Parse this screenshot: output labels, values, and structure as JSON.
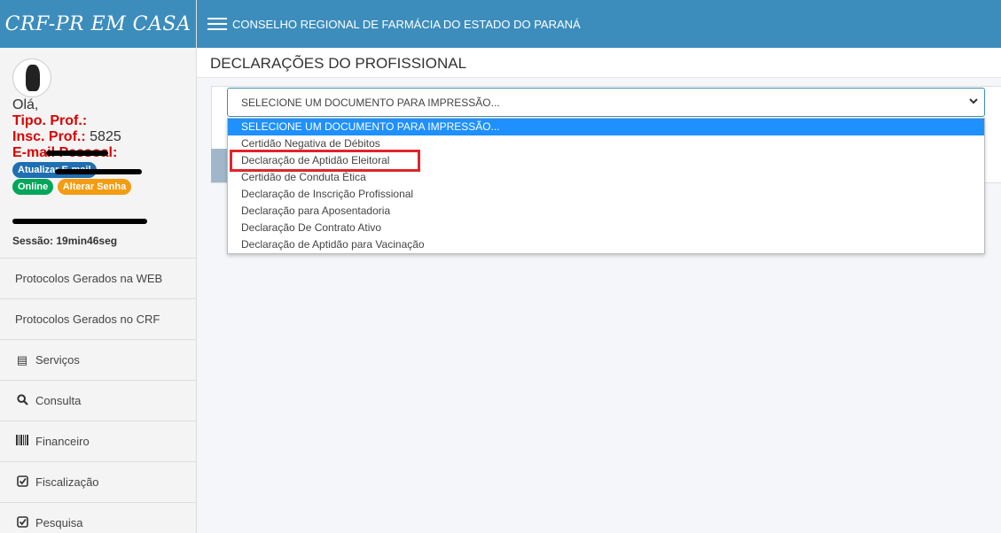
{
  "brand": "CRF-PR EM CASA",
  "header": {
    "title": "CONSELHO REGIONAL DE FARMÁCIA DO ESTADO DO PARANÁ"
  },
  "user": {
    "greeting": "Olá,",
    "tipo_label": "Tipo. Prof.:",
    "insc_label": "Insc. Prof.:",
    "insc_value": "5825",
    "email_label": "E-mail Pessoal:",
    "update_email": "Atualizar E-mail",
    "online": "Online",
    "change_password": "Alterar Senha",
    "session": "Sessão: 19min46seg"
  },
  "menu": [
    {
      "label": "Protocolos Gerados na WEB",
      "icon": ""
    },
    {
      "label": "Protocolos Gerados no CRF",
      "icon": ""
    },
    {
      "label": "Serviços",
      "icon": "list-icon"
    },
    {
      "label": "Consulta",
      "icon": "search-icon"
    },
    {
      "label": "Financeiro",
      "icon": "barcode-icon"
    },
    {
      "label": "Fiscalização",
      "icon": "check-square-icon"
    },
    {
      "label": "Pesquisa",
      "icon": "check-square-icon"
    }
  ],
  "page": {
    "title": "DECLARAÇÕES DO PROFISSIONAL"
  },
  "select": {
    "value": "SELECIONE UM DOCUMENTO PARA IMPRESSÃO...",
    "options": [
      "SELECIONE UM DOCUMENTO PARA IMPRESSÃO...",
      "Certidão Negativa de Débitos",
      "Declaração de Aptidão Eleitoral",
      "Certidão de Conduta Ética",
      "Declaração de Inscrição Profissional",
      "Declaração para Aposentadoria",
      "Declaração De Contrato Ativo",
      "Declaração de Aptidão para Vacinação"
    ]
  },
  "colors": {
    "header": "#3c8dbc",
    "highlight": "#e0242b",
    "selected_option": "#1e90ff"
  }
}
